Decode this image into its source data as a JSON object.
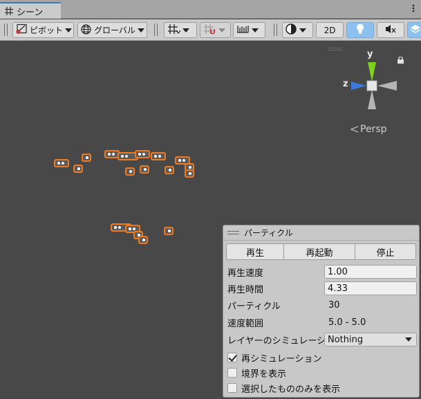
{
  "window": {
    "tab_label": "シーン"
  },
  "toolbar": {
    "pivot_label": "ピボット",
    "global_label": "グローバル",
    "mode_2d_label": "2D"
  },
  "gizmo": {
    "y_label": "y",
    "z_label": "z",
    "projection_label": "Persp"
  },
  "particle_panel": {
    "title": "パーティクル",
    "buttons": {
      "play": "再生",
      "restart": "再起動",
      "stop": "停止"
    },
    "rows": {
      "playback_speed": {
        "label": "再生速度",
        "value": "1.00"
      },
      "playback_time": {
        "label": "再生時間",
        "value": "4.33"
      },
      "particles": {
        "label": "パーティクル",
        "value": "30"
      },
      "speed_range": {
        "label": "速度範囲",
        "value": "5.0 - 5.0"
      },
      "simulate_layers": {
        "label": "レイヤーのシミュレーション",
        "value": "Nothing"
      }
    },
    "checkboxes": {
      "resimulate": {
        "label": "再シミュレーション",
        "checked": true
      },
      "show_bounds": {
        "label": "境界を表示",
        "checked": false
      },
      "show_only_selected": {
        "label": "選択したもののみを表示",
        "checked": false
      }
    }
  },
  "colors": {
    "accent_tab": "#3a79bb",
    "particle_outline": "#f07a1f",
    "axis_y": "#7ed321",
    "axis_z": "#3b7be0",
    "scene_bg": "#484848",
    "active_toggle": "#8cc1ef"
  }
}
